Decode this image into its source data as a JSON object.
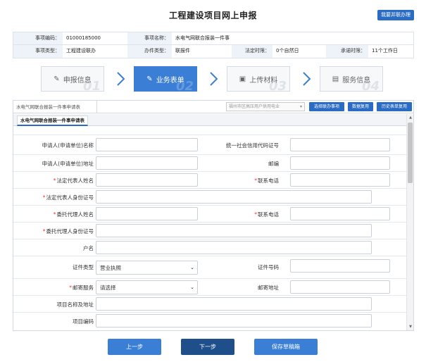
{
  "header": {
    "title": "工程建设项目网上申报",
    "top_button": "我要并联办理"
  },
  "info": {
    "row1": {
      "label1": "事项编码：",
      "value1": "01000185000",
      "label2": "事项名称：",
      "value2": "水电气网联合报装一件事"
    },
    "row2": {
      "label1": "事项类型：",
      "value1": "工程建设联办",
      "label2": "办件类型：",
      "value2": "联报件",
      "label3": "法定时限：",
      "value3": "0个自然日",
      "label4": "承诺时限：",
      "value4": "11个工作日"
    }
  },
  "steps": [
    {
      "label": "申报信息",
      "num": "01",
      "icon": "edit-icon"
    },
    {
      "label": "业务表单",
      "num": "02",
      "icon": "edit-icon"
    },
    {
      "label": "上传材料",
      "num": "03",
      "icon": "folder-icon"
    },
    {
      "label": "服务信息",
      "num": "04",
      "icon": "calendar-icon"
    }
  ],
  "tabs": {
    "main_tab": "水电气网联合报装一件事申请表",
    "select_placeholder": "福州市区高压用户供用电业",
    "btn_select_linked": "选择联办事项",
    "btn_data_reuse": "数据复用",
    "btn_history_reuse": "历史表单复用",
    "subtab": "水电气网联合报装一件事申请表"
  },
  "form": {
    "applicant_name": "申请人(申请单位)名称",
    "credit_code": "统一社会信用代码证号",
    "applicant_address": "申请人(申请单位)地址",
    "postcode": "邮编",
    "legal_rep_name": "法定代表人姓名",
    "contact_phone": "联系电话",
    "legal_rep_id": "法定代表人身份证号",
    "agent_name": "委托代理人姓名",
    "contact_phone2": "联系电话",
    "agent_id": "委托代理人身份证号",
    "account_name": "户名",
    "cert_type": "证件类型",
    "cert_type_value": "营业执照",
    "cert_number": "证件号码",
    "mail_service": "邮寄服务",
    "mail_service_value": "请选择",
    "mail_address": "邮寄地址",
    "project_name": "项目名称及地址",
    "project_code": "项目编码"
  },
  "footer": {
    "prev": "上一步",
    "next": "下一步",
    "save": "保存草稿箱"
  },
  "colors": {
    "primary": "#2a6bc4",
    "step_active": "#3a7fd5",
    "next_button": "#1e4f8a",
    "required": "#e33333"
  }
}
